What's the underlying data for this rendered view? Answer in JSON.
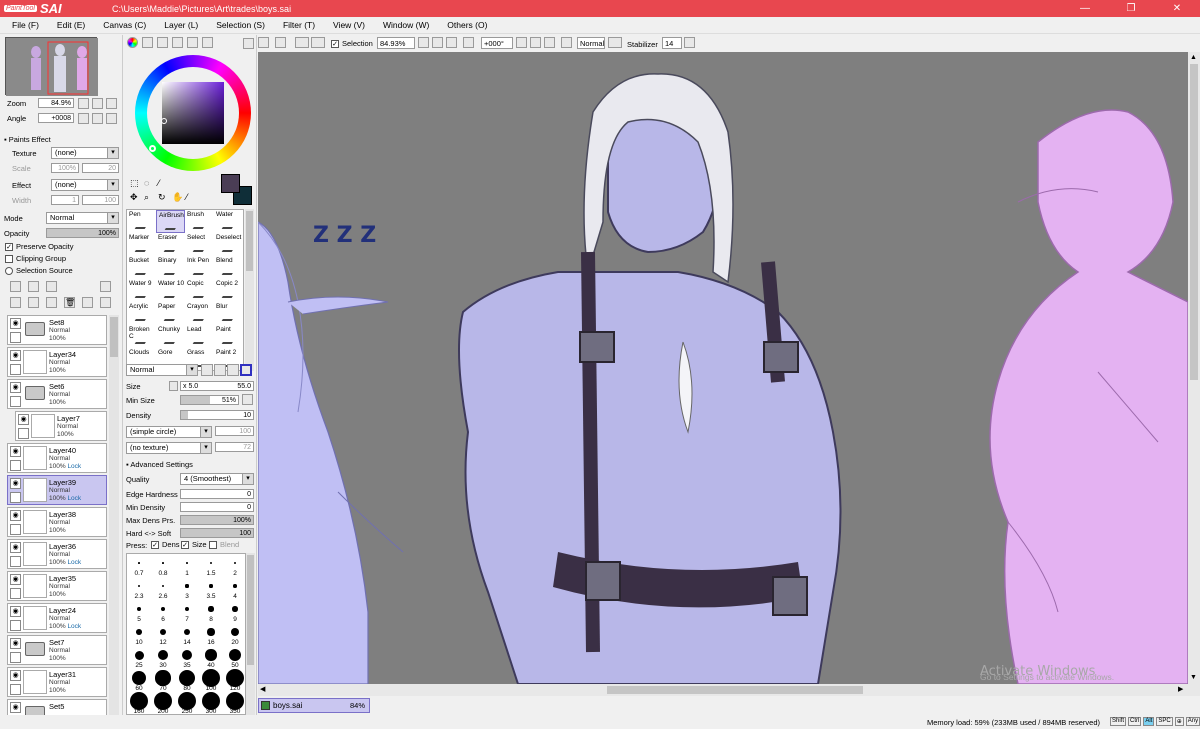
{
  "app": {
    "logo_small": "PaintTool",
    "logo_big": "SAI",
    "path": "C:\\Users\\Maddie\\Pictures\\Art\\trades\\boys.sai",
    "min": "—",
    "max": "❐",
    "close": "✕"
  },
  "menu": [
    "File (F)",
    "Edit (E)",
    "Canvas (C)",
    "Layer (L)",
    "Selection (S)",
    "Filter (T)",
    "View (V)",
    "Window (W)",
    "Others (O)"
  ],
  "navigator": {
    "zoom_label": "Zoom",
    "zoom_value": "84.9%",
    "angle_label": "Angle",
    "angle_value": "+0008"
  },
  "paints_effect": {
    "header": "Paints Effect",
    "texture_label": "Texture",
    "texture_value": "(none)",
    "scale_label": "Scale",
    "scale_value": "100%",
    "scale_num": "20",
    "effect_label": "Effect",
    "effect_value": "(none)",
    "width_label": "Width",
    "width_value": "1",
    "width_num": "100"
  },
  "layer_props": {
    "mode_label": "Mode",
    "mode_value": "Normal",
    "opacity_label": "Opacity",
    "opacity_value": "100%",
    "opacity_level": 1.0,
    "preserve_opacity": "Preserve Opacity",
    "clipping_group": "Clipping Group",
    "selection_source": "Selection Source"
  },
  "layers": [
    {
      "name": "Set8",
      "mode": "Normal",
      "opacity": "100%",
      "lock": "",
      "folder": true
    },
    {
      "name": "Layer34",
      "mode": "Normal",
      "opacity": "100%",
      "lock": "",
      "folder": false
    },
    {
      "name": "Set6",
      "mode": "Normal",
      "opacity": "100%",
      "lock": "",
      "folder": true
    },
    {
      "name": "Layer7",
      "mode": "Normal",
      "opacity": "100%",
      "lock": "",
      "folder": false
    },
    {
      "name": "Layer40",
      "mode": "Normal",
      "opacity": "100%",
      "lock": "Lock",
      "folder": false
    },
    {
      "name": "Layer39",
      "mode": "Normal",
      "opacity": "100%",
      "lock": "Lock",
      "folder": false
    },
    {
      "name": "Layer38",
      "mode": "Normal",
      "opacity": "100%",
      "lock": "",
      "folder": false
    },
    {
      "name": "Layer36",
      "mode": "Normal",
      "opacity": "100%",
      "lock": "Lock",
      "folder": false
    },
    {
      "name": "Layer35",
      "mode": "Normal",
      "opacity": "100%",
      "lock": "",
      "folder": false
    },
    {
      "name": "Layer24",
      "mode": "Normal",
      "opacity": "100%",
      "lock": "Lock",
      "folder": false
    },
    {
      "name": "Set7",
      "mode": "Normal",
      "opacity": "100%",
      "lock": "",
      "folder": true
    },
    {
      "name": "Layer31",
      "mode": "Normal",
      "opacity": "100%",
      "lock": "",
      "folder": false
    },
    {
      "name": "Set5",
      "mode": "",
      "opacity": "",
      "lock": "",
      "folder": true
    }
  ],
  "tools": [
    [
      "Pen",
      "AirBrush",
      "Brush",
      "Water"
    ],
    [
      "Marker",
      "Eraser",
      "Select",
      "Deselect"
    ],
    [
      "Bucket",
      "Binary",
      "Ink Pen",
      "Blend"
    ],
    [
      "Water 9",
      "Water 10",
      "Copic",
      "Copic 2"
    ],
    [
      "Acrylic",
      "Paper",
      "Crayon",
      "Blur"
    ],
    [
      "Broken C",
      "Chunky",
      "Lead",
      "Paint"
    ],
    [
      "Clouds",
      "Gore",
      "Grass",
      "Paint 2"
    ]
  ],
  "brush": {
    "blend_mode": "Normal",
    "size_label": "Size",
    "size_mult": "x 5.0",
    "size_value": "55.0",
    "min_size_label": "Min Size",
    "min_size_value": "51%",
    "min_size_level": 0.51,
    "density_label": "Density",
    "density_value": "10",
    "density_level": 0.1,
    "shape": "(simple circle)",
    "shape_num": "100",
    "texture": "(no texture)",
    "texture_num": "72",
    "advanced": "Advanced Settings",
    "quality_label": "Quality",
    "quality_value": "4 (Smoothest)",
    "edge_hardness_label": "Edge Hardness",
    "edge_hardness_value": "0",
    "min_density_label": "Min Density",
    "min_density_value": "0",
    "max_dens_label": "Max Dens Prs.",
    "max_dens_value": "100%",
    "max_dens_level": 1.0,
    "hard_soft_label": "Hard <-> Soft",
    "hard_soft_value": "100",
    "hard_soft_level": 1.0,
    "press_label": "Press:",
    "dens_label": "Dens",
    "size_chk_label": "Size",
    "blend_label": "Blend"
  },
  "brush_sizes": [
    "0.7",
    "0.8",
    "1",
    "1.5",
    "2",
    "2.3",
    "2.6",
    "3",
    "3.5",
    "4",
    "5",
    "6",
    "7",
    "8",
    "9",
    "10",
    "12",
    "14",
    "16",
    "20",
    "25",
    "30",
    "35",
    "40",
    "50",
    "60",
    "70",
    "80",
    "100",
    "120",
    "160",
    "200",
    "250",
    "300",
    "350"
  ],
  "toolbar": {
    "selection_label": "Selection",
    "zoom_value": "84.93%",
    "angle_value": "+000°",
    "mode_value": "Normal",
    "stabilizer_label": "Stabilizer",
    "stabilizer_value": "14"
  },
  "canvas_tab": {
    "name": "boys.sai",
    "zoom": "84%"
  },
  "watermark": {
    "line1": "Activate Windows",
    "line2": "Go to Settings to activate Windows."
  },
  "zzz": "Z Z Z",
  "status": {
    "memory": "Memory load: 59% (233MB used / 894MB reserved)",
    "keys": [
      "Shift",
      "Ctrl",
      "Alt",
      "SPC",
      "⊕",
      "Any"
    ]
  },
  "colors": {
    "title_bar": "#e8474f",
    "canvas_bg": "#7f7f7f",
    "primary_color": "#4a3d55",
    "secondary_color": "#0f2e38",
    "selected_layer": "#c9c6f0"
  }
}
